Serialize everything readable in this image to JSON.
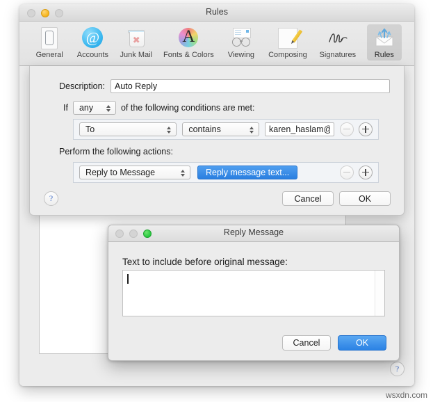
{
  "main_window": {
    "title": "Rules",
    "traffic_lights": [
      "close-disabled",
      "minimize-yellow",
      "zoom-disabled"
    ],
    "toolbar": [
      {
        "label": "General",
        "icon": "general-icon",
        "selected": false
      },
      {
        "label": "Accounts",
        "icon": "accounts-icon",
        "selected": false
      },
      {
        "label": "Junk Mail",
        "icon": "junk-mail-icon",
        "selected": false
      },
      {
        "label": "Fonts & Colors",
        "icon": "fonts-colors-icon",
        "selected": false
      },
      {
        "label": "Viewing",
        "icon": "viewing-icon",
        "selected": false
      },
      {
        "label": "Composing",
        "icon": "composing-icon",
        "selected": false
      },
      {
        "label": "Signatures",
        "icon": "signatures-icon",
        "selected": false
      },
      {
        "label": "Rules",
        "icon": "rules-icon",
        "selected": true
      }
    ],
    "help_label": "?"
  },
  "rule_sheet": {
    "description_label": "Description:",
    "description_value": "Auto Reply",
    "description_placeholder": "",
    "if_label": "If",
    "match_value": "any",
    "conditions_label": "of the following conditions are met:",
    "condition": {
      "field": "To",
      "operator": "contains",
      "value": "karen_haslam@idg",
      "value_placeholder": "",
      "remove_label": "−",
      "add_label": "+"
    },
    "actions_label": "Perform the following actions:",
    "action": {
      "type": "Reply to Message",
      "button_label": "Reply message text...",
      "remove_label": "−",
      "add_label": "+"
    },
    "help_label": "?",
    "cancel_label": "Cancel",
    "ok_label": "OK"
  },
  "reply_window": {
    "title": "Reply Message",
    "traffic_lights": [
      "close-disabled",
      "minimize-disabled",
      "zoom-green"
    ],
    "prompt": "Text to include before original message:",
    "text_value": "",
    "cancel_label": "Cancel",
    "ok_label": "OK"
  },
  "watermark": "wsxdn.com",
  "colors": {
    "accent_blue": "#2a7fe0",
    "default_button_blue": "#2b82e4",
    "window_gray": "#ececec",
    "band_gray": "#f2f4f7",
    "traffic_yellow": "#f6b319",
    "traffic_green": "#27c93f"
  }
}
